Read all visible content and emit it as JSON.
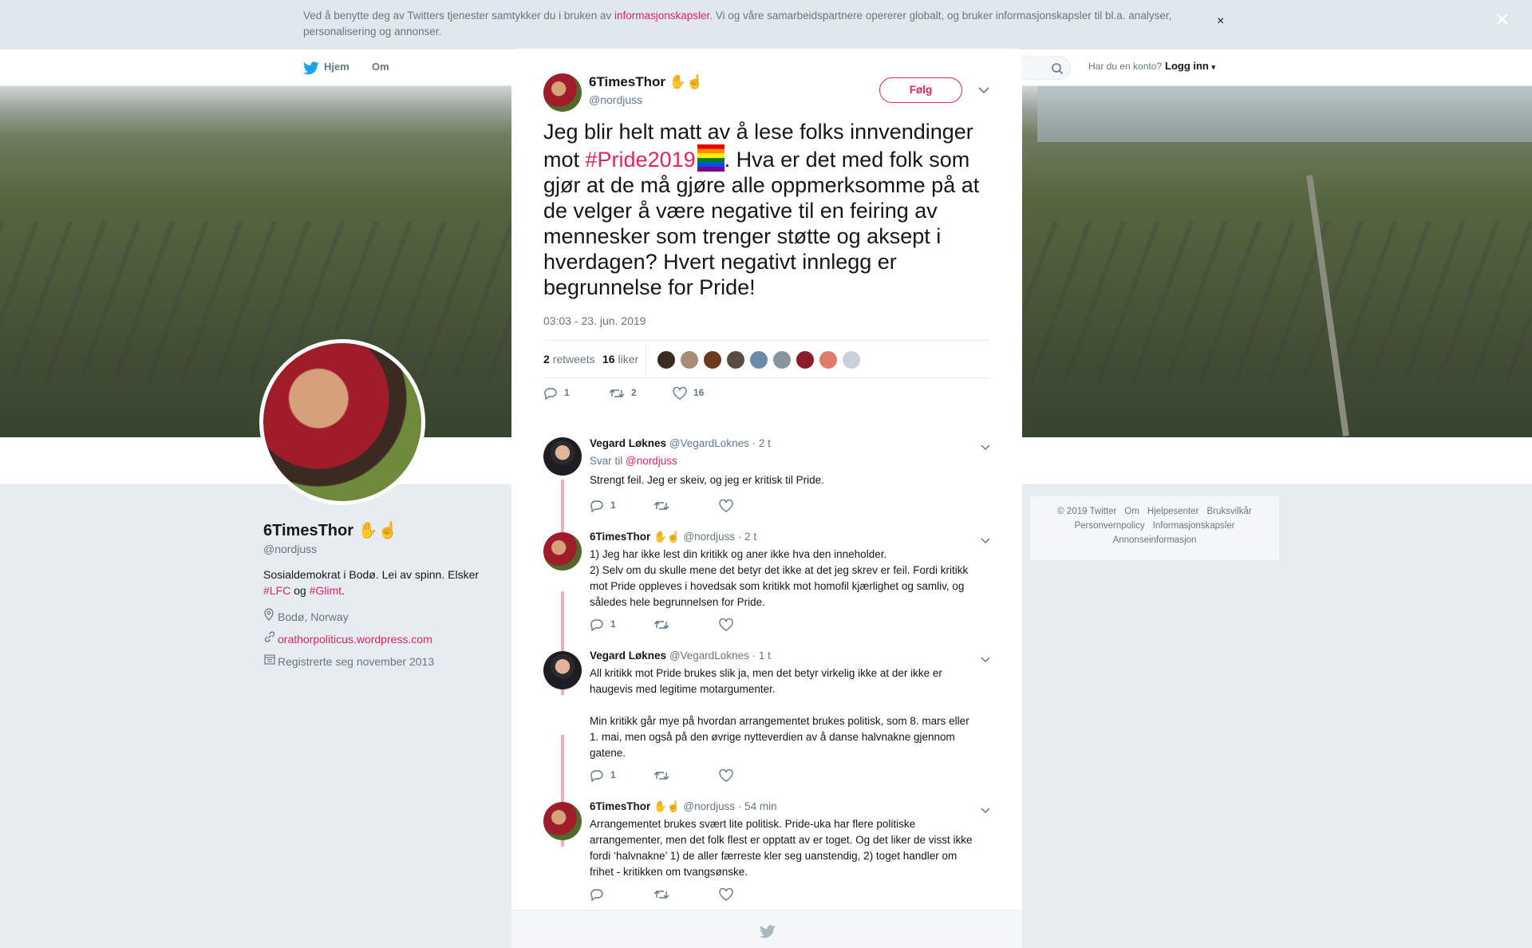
{
  "cookie": {
    "text_before": "Ved å benytte deg av Twitters tjenester samtykker du i bruken av ",
    "link": "informasjonskapsler",
    "text_after": ". Vi og våre samarbeidspartnere opererer globalt, og bruker informasjonskapsler til bl.a. analyser, personalisering og annonser.",
    "close": "×"
  },
  "nav": {
    "home": "Hjem",
    "about": "Om",
    "account_prompt": "Har du en konto?",
    "login": "Logg inn"
  },
  "profile": {
    "name": "6TimesThor ✋☝",
    "handle": "@nordjuss",
    "bio_text": "Sosialdemokrat i Bodø. Lei av spinn. Elsker",
    "bio_tag1": "#LFC",
    "bio_and": " og ",
    "bio_tag2": "#Glimt",
    "bio_end": ".",
    "location": "Bodø, Norway",
    "website": "orathorpoliticus.wordpress.com",
    "joined": "Registrerte seg november 2013"
  },
  "footer": {
    "links_row1": [
      "© 2019 Twitter",
      "Om",
      "Hjelpesenter",
      "Bruksvilkår"
    ],
    "links_row2": [
      "Personvernpolicy",
      "Informasjonskapsler"
    ],
    "links_row3": [
      "Annonseinformasjon"
    ]
  },
  "overlay": {
    "close": "×"
  },
  "tweet": {
    "name": "6TimesThor ✋☝",
    "handle": "@nordjuss",
    "follow": "Følg",
    "text_1": "Jeg blir helt matt av å lese folks innvendinger mot ",
    "hashtag": "#Pride2019",
    "text_2": ". Hva er det med folk som gjør at de må gjøre alle oppmerksomme på at de velger å være negative til en feiring av mennesker som trenger støtte og aksept i hverdagen? Hvert negativt innlegg er begrunnelse for Pride!",
    "date": "03:03 - 23. jun. 2019",
    "retweets_count": "2",
    "retweets_label": "retweets",
    "likes_count": "16",
    "likes_label": "liker",
    "reply_count": "1",
    "retweet_count_action": "2",
    "like_count_action": "16"
  },
  "replies": [
    {
      "name": "Vegard Løknes",
      "handle": "@VegardLoknes",
      "time": "· 2 t",
      "reply_to_label": "Svar til ",
      "reply_to": "@nordjuss",
      "text": "Strengt feil. Jeg er skeiv, og jeg er kritisk til Pride.",
      "reply_count": "1"
    },
    {
      "name": "6TimesThor ✋☝",
      "handle": "@nordjuss",
      "time": "· 2 t",
      "text_lines": [
        "1) Jeg har ikke lest din kritikk og aner ikke hva den inneholder.",
        "2) Selv om du skulle mene det betyr det ikke at det jeg skrev er feil. Fordi kritikk",
        "mot Pride oppleves i hovedsak som kritikk mot homofil kjærlighet og samliv, og",
        "således hele begrunnelsen for Pride."
      ],
      "reply_count": "1"
    },
    {
      "name": "Vegard Løknes",
      "handle": "@VegardLoknes",
      "time": "· 1 t",
      "text_lines": [
        "All kritikk mot Pride brukes slik ja, men det betyr virkelig ikke at der ikke er",
        "haugevis med legitime motargumenter.",
        "",
        "Min kritikk går mye på hvordan arrangementet brukes politisk, som 8. mars eller",
        "1. mai, men også på den øvrige nytteverdien av å danse halvnakne gjennom",
        "gatene."
      ],
      "reply_count": "1"
    },
    {
      "name": "6TimesThor ✋☝",
      "handle": "@nordjuss",
      "time": "· 54 min",
      "text_lines": [
        "Arrangementet brukes svært lite politisk. Pride-uka har flere politiske",
        "arrangementer, men det folk flest er opptatt av er toget. Og det liker de visst ikke",
        "fordi ‘halvnakne’ 1) de aller færreste kler seg uanstendig, 2) toget handler om",
        "frihet - kritikken om tvangsønske."
      ]
    }
  ],
  "colors": {
    "accent": "#e0245e",
    "thread": "#f4abba",
    "muted": "#657786"
  }
}
